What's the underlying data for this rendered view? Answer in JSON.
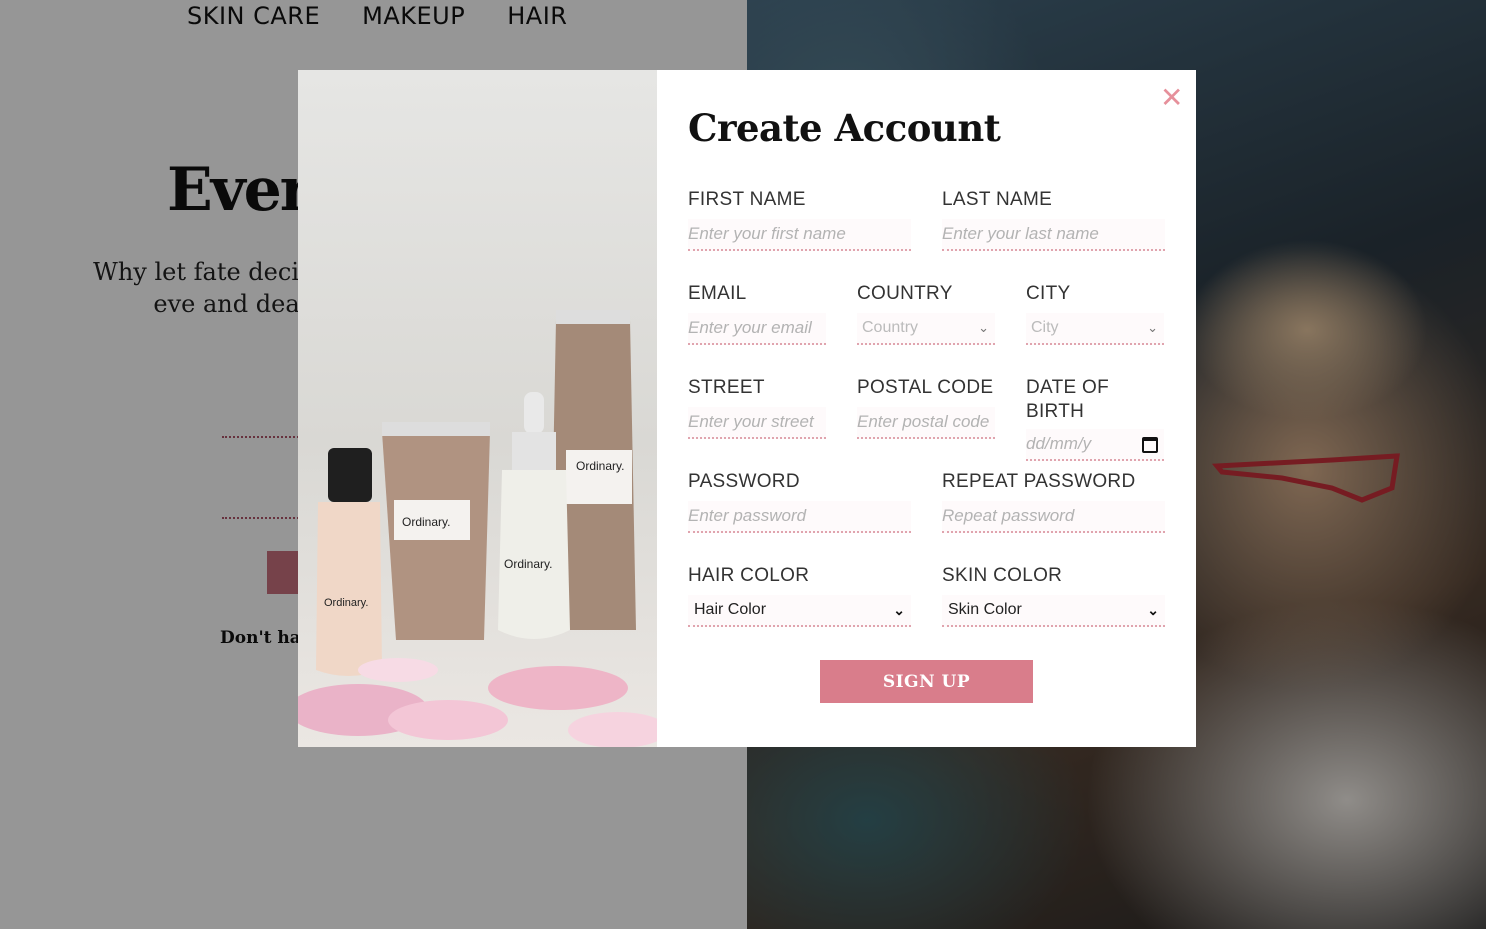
{
  "nav": {
    "items": [
      {
        "label": "SKIN CARE"
      },
      {
        "label": "MAKEUP"
      },
      {
        "label": "HAIR"
      }
    ]
  },
  "hero": {
    "title": "Every",
    "text": "Why let fate decid look your best eve and deals to match",
    "small_text": "Don't hav"
  },
  "modal": {
    "title": "Create Account",
    "close_icon": "close-icon",
    "fields": {
      "first_name": {
        "label": "FIRST NAME",
        "placeholder": "Enter your first name"
      },
      "last_name": {
        "label": "LAST NAME",
        "placeholder": "Enter your last name"
      },
      "email": {
        "label": "EMAIL",
        "placeholder": "Enter your email"
      },
      "country": {
        "label": "COUNTRY",
        "value": "Country"
      },
      "city": {
        "label": "CITY",
        "value": "City"
      },
      "street": {
        "label": "STREET",
        "placeholder": "Enter your street"
      },
      "postal_code": {
        "label": "POSTAL CODE",
        "placeholder": "Enter postal code"
      },
      "dob": {
        "label": "DATE OF BIRTH",
        "placeholder": "dd/mm/y"
      },
      "password": {
        "label": "PASSWORD",
        "placeholder": "Enter password"
      },
      "repeat_password": {
        "label": "REPEAT PASSWORD",
        "placeholder": "Repeat password"
      },
      "hair_color": {
        "label": "HAIR COLOR",
        "value": "Hair Color"
      },
      "skin_color": {
        "label": "SKIN COLOR",
        "value": "Skin Color"
      }
    },
    "submit_label": "SIGN UP",
    "product_labels": {
      "brand_1": "Ordinary.",
      "brand_2": "Ordinary.",
      "brand_3": "Ordinary.",
      "brand_4": "Ordinary."
    }
  },
  "colors": {
    "accent": "#d97d8b",
    "close": "#e6909b",
    "dotted_border": "#e0a4ae"
  }
}
